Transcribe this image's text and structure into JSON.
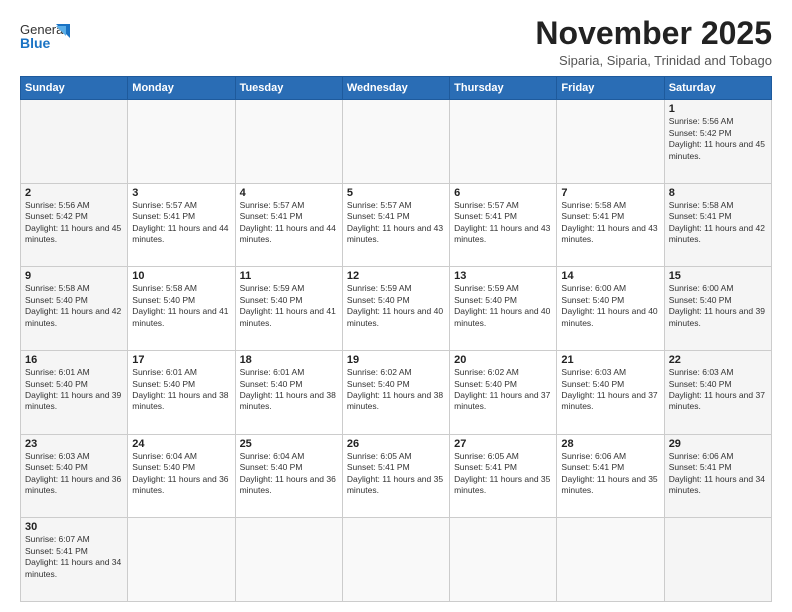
{
  "header": {
    "logo_general": "General",
    "logo_blue": "Blue",
    "month_title": "November 2025",
    "subtitle": "Siparia, Siparia, Trinidad and Tobago"
  },
  "weekdays": [
    "Sunday",
    "Monday",
    "Tuesday",
    "Wednesday",
    "Thursday",
    "Friday",
    "Saturday"
  ],
  "weeks": [
    [
      null,
      null,
      null,
      null,
      null,
      null,
      {
        "day": 1,
        "sunrise": "5:56 AM",
        "sunset": "5:42 PM",
        "daylight": "11 hours and 45 minutes."
      }
    ],
    [
      {
        "day": 2,
        "sunrise": "5:56 AM",
        "sunset": "5:42 PM",
        "daylight": "11 hours and 45 minutes."
      },
      {
        "day": 3,
        "sunrise": "5:57 AM",
        "sunset": "5:41 PM",
        "daylight": "11 hours and 44 minutes."
      },
      {
        "day": 4,
        "sunrise": "5:57 AM",
        "sunset": "5:41 PM",
        "daylight": "11 hours and 44 minutes."
      },
      {
        "day": 5,
        "sunrise": "5:57 AM",
        "sunset": "5:41 PM",
        "daylight": "11 hours and 43 minutes."
      },
      {
        "day": 6,
        "sunrise": "5:57 AM",
        "sunset": "5:41 PM",
        "daylight": "11 hours and 43 minutes."
      },
      {
        "day": 7,
        "sunrise": "5:58 AM",
        "sunset": "5:41 PM",
        "daylight": "11 hours and 43 minutes."
      },
      {
        "day": 8,
        "sunrise": "5:58 AM",
        "sunset": "5:41 PM",
        "daylight": "11 hours and 42 minutes."
      }
    ],
    [
      {
        "day": 9,
        "sunrise": "5:58 AM",
        "sunset": "5:40 PM",
        "daylight": "11 hours and 42 minutes."
      },
      {
        "day": 10,
        "sunrise": "5:58 AM",
        "sunset": "5:40 PM",
        "daylight": "11 hours and 41 minutes."
      },
      {
        "day": 11,
        "sunrise": "5:59 AM",
        "sunset": "5:40 PM",
        "daylight": "11 hours and 41 minutes."
      },
      {
        "day": 12,
        "sunrise": "5:59 AM",
        "sunset": "5:40 PM",
        "daylight": "11 hours and 40 minutes."
      },
      {
        "day": 13,
        "sunrise": "5:59 AM",
        "sunset": "5:40 PM",
        "daylight": "11 hours and 40 minutes."
      },
      {
        "day": 14,
        "sunrise": "6:00 AM",
        "sunset": "5:40 PM",
        "daylight": "11 hours and 40 minutes."
      },
      {
        "day": 15,
        "sunrise": "6:00 AM",
        "sunset": "5:40 PM",
        "daylight": "11 hours and 39 minutes."
      }
    ],
    [
      {
        "day": 16,
        "sunrise": "6:01 AM",
        "sunset": "5:40 PM",
        "daylight": "11 hours and 39 minutes."
      },
      {
        "day": 17,
        "sunrise": "6:01 AM",
        "sunset": "5:40 PM",
        "daylight": "11 hours and 38 minutes."
      },
      {
        "day": 18,
        "sunrise": "6:01 AM",
        "sunset": "5:40 PM",
        "daylight": "11 hours and 38 minutes."
      },
      {
        "day": 19,
        "sunrise": "6:02 AM",
        "sunset": "5:40 PM",
        "daylight": "11 hours and 38 minutes."
      },
      {
        "day": 20,
        "sunrise": "6:02 AM",
        "sunset": "5:40 PM",
        "daylight": "11 hours and 37 minutes."
      },
      {
        "day": 21,
        "sunrise": "6:03 AM",
        "sunset": "5:40 PM",
        "daylight": "11 hours and 37 minutes."
      },
      {
        "day": 22,
        "sunrise": "6:03 AM",
        "sunset": "5:40 PM",
        "daylight": "11 hours and 37 minutes."
      }
    ],
    [
      {
        "day": 23,
        "sunrise": "6:03 AM",
        "sunset": "5:40 PM",
        "daylight": "11 hours and 36 minutes."
      },
      {
        "day": 24,
        "sunrise": "6:04 AM",
        "sunset": "5:40 PM",
        "daylight": "11 hours and 36 minutes."
      },
      {
        "day": 25,
        "sunrise": "6:04 AM",
        "sunset": "5:40 PM",
        "daylight": "11 hours and 36 minutes."
      },
      {
        "day": 26,
        "sunrise": "6:05 AM",
        "sunset": "5:41 PM",
        "daylight": "11 hours and 35 minutes."
      },
      {
        "day": 27,
        "sunrise": "6:05 AM",
        "sunset": "5:41 PM",
        "daylight": "11 hours and 35 minutes."
      },
      {
        "day": 28,
        "sunrise": "6:06 AM",
        "sunset": "5:41 PM",
        "daylight": "11 hours and 35 minutes."
      },
      {
        "day": 29,
        "sunrise": "6:06 AM",
        "sunset": "5:41 PM",
        "daylight": "11 hours and 34 minutes."
      }
    ],
    [
      {
        "day": 30,
        "sunrise": "6:07 AM",
        "sunset": "5:41 PM",
        "daylight": "11 hours and 34 minutes."
      },
      null,
      null,
      null,
      null,
      null,
      null
    ]
  ]
}
